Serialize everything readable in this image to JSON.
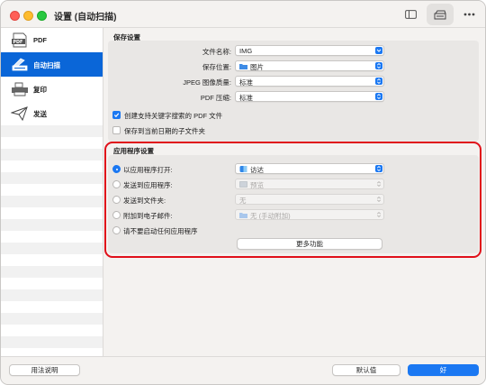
{
  "window": {
    "title": "设置 (自动扫描)"
  },
  "toolbar": {
    "sidebar_icon": "sidebar-toggle-icon",
    "scanner_icon": "scanner-icon",
    "more_icon": "ellipsis-icon"
  },
  "sidebar": {
    "items": [
      {
        "label": "PDF",
        "icon": "pdf-icon",
        "selected": false
      },
      {
        "label": "自动扫描",
        "icon": "scanner-icon",
        "selected": true
      },
      {
        "label": "复印",
        "icon": "printer-icon",
        "selected": false
      },
      {
        "label": "发送",
        "icon": "paper-plane-icon",
        "selected": false
      }
    ]
  },
  "save_settings": {
    "title": "保存设置",
    "file_name": {
      "label": "文件名称:",
      "value": "IMG"
    },
    "save_location": {
      "label": "保存位置:",
      "value": "图片",
      "icon": "folder-icon"
    },
    "jpeg_quality": {
      "label": "JPEG 图像质量:",
      "value": "标准"
    },
    "pdf_compression": {
      "label": "PDF 压缩:",
      "value": "标准"
    },
    "create_searchable_pdf": {
      "label": "创建支持关键字搜索的 PDF 文件",
      "checked": true
    },
    "save_to_date_subfolder": {
      "label": "保存到当前日期的子文件夹",
      "checked": false
    }
  },
  "app_settings": {
    "title": "应用程序设置",
    "options": [
      {
        "label": "以应用程序打开:",
        "value": "访达",
        "icon": "finder-icon",
        "selected": true,
        "enabled": true
      },
      {
        "label": "发送到应用程序:",
        "value": "预览",
        "icon": "preview-icon",
        "selected": false,
        "enabled": false
      },
      {
        "label": "发送到文件夹:",
        "value": "无",
        "selected": false,
        "enabled": false
      },
      {
        "label": "附加到电子邮件:",
        "value": "无 (手动附加)",
        "icon": "folder-icon",
        "selected": false,
        "enabled": false
      },
      {
        "label": "请不要启动任何应用程序",
        "selected": false,
        "enabled": true
      }
    ],
    "more_functions": "更多功能"
  },
  "footer": {
    "help": "用法说明",
    "defaults": "默认值",
    "ok": "好"
  },
  "colors": {
    "accent": "#1b78f2",
    "highlight_border": "#e0101a",
    "sidebar_selected": "#0a66d8"
  }
}
